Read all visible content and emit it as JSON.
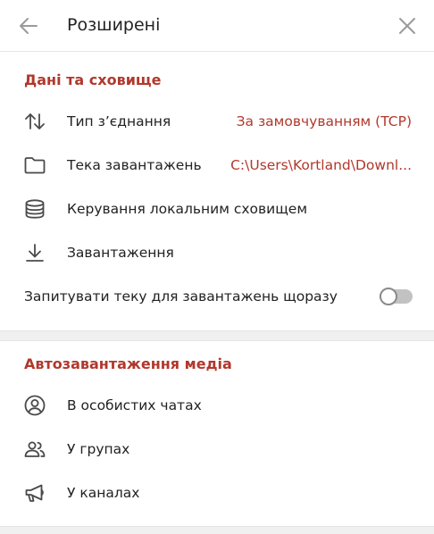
{
  "header": {
    "title": "Розширені",
    "back_icon": "arrow-left-icon",
    "close_icon": "close-icon"
  },
  "sections": [
    {
      "title": "Дані та сховище",
      "items": [
        {
          "label": "Тип з’єднання",
          "value": "За замовчуванням (TCP)",
          "icon": "arrows-updown-icon"
        },
        {
          "label": "Тека завантажень",
          "value": "C:\\Users\\Kortland\\Downl...",
          "icon": "folder-icon"
        },
        {
          "label": "Керування локальним сховищем",
          "icon": "database-icon"
        },
        {
          "label": "Завантаження",
          "icon": "download-icon"
        }
      ],
      "toggle_row": {
        "label": "Запитувати теку для завантажень щоразу",
        "enabled": false
      }
    },
    {
      "title": "Автозавантаження медіа",
      "items": [
        {
          "label": "В особистих чатах",
          "icon": "user-circle-icon"
        },
        {
          "label": "У групах",
          "icon": "group-icon"
        },
        {
          "label": "У каналах",
          "icon": "megaphone-icon"
        }
      ]
    }
  ],
  "colors": {
    "accent": "#b1382c",
    "text": "#222222",
    "icon": "#4a4a4a",
    "divider": "#f0f0f0"
  }
}
